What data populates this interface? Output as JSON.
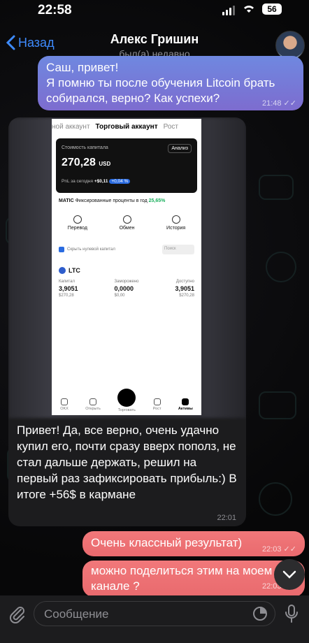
{
  "status": {
    "time": "22:58",
    "battery": "56"
  },
  "header": {
    "back_label": "Назад",
    "title": "Алекс Гришин",
    "subtitle": "был(а) недавно"
  },
  "messages": {
    "out1": {
      "text": "Саш, привет!\nЯ помню ты после обучения Litcoin брать собирался, верно? Как успехи?",
      "time": "21:48"
    },
    "in1": {
      "text": "Привет! Да, все верно, очень удачно купил его, почти сразу вверх пополз, не стал дальше держать, решил на первый раз зафиксировать прибыль:) В итоге +56$ в кармане",
      "time": "22:01",
      "screenshot": {
        "tabs": [
          "ной аккаунт",
          "Торговый аккаунт",
          "Рост"
        ],
        "capital_label": "Стоимость капитала",
        "analysis_label": "Анализ",
        "value": "270,28",
        "currency": "USD",
        "pnl_label": "PnL за сегодня",
        "pnl_value": "+$0,11",
        "pnl_pct": "+0,04 %",
        "matic_name": "MATIC",
        "matic_text": "Фиксированные проценты в год",
        "matic_pct": "25,65%",
        "actions": [
          "Перевод",
          "Обмен",
          "История"
        ],
        "hide_zero": "Скрыть нулевой капитал",
        "search_placeholder": "Поиск",
        "coin": "LTC",
        "cols": [
          {
            "label": "Капитал",
            "value": "3,9051",
            "usd": "$270,28"
          },
          {
            "label": "Заморожено",
            "value": "0,0000",
            "usd": "$0,00"
          },
          {
            "label": "Доступно",
            "value": "3,9051",
            "usd": "$270,28"
          }
        ],
        "nav": [
          "OKX",
          "Открыть",
          "Торговать",
          "Рост",
          "Активы"
        ]
      }
    },
    "out2": {
      "text": "Очень классный результат)",
      "time": "22:03"
    },
    "out3": {
      "text": "можно поделиться этим на моем канале ?",
      "time": "22:03"
    }
  },
  "input": {
    "placeholder": "Сообщение"
  }
}
